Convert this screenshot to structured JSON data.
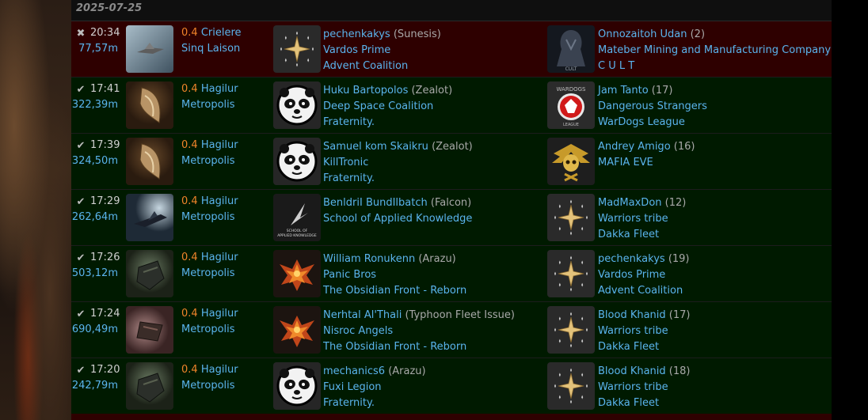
{
  "date": "2025-07-25",
  "kills": [
    {
      "type": "loss",
      "status_icon": "close-icon",
      "status_glyph": "✖",
      "time": "20:34",
      "isk": "77,57m",
      "ship_icon": "frigate-ship-icon",
      "security": "0.4",
      "system": "Crielere",
      "region": "Sinq Laison",
      "victim": {
        "logo": "star-emblem-icon",
        "pilot": "pechenkakys",
        "ship": "(Sunesis)",
        "corp": "Vardos Prime",
        "alliance": "Advent Coalition"
      },
      "final_blow": {
        "logo": "cult-dark-icon",
        "pilot": "Onnozaitoh Udan",
        "count": "(2)",
        "corp": "Mateber Mining and Manufacturing Company",
        "alliance": "C U L T"
      }
    },
    {
      "type": "win",
      "status_icon": "check-icon",
      "status_glyph": "✔",
      "time": "17:41",
      "isk": "322,39m",
      "ship_icon": "zealot-ship-icon",
      "security": "0.4",
      "system": "Hagilur",
      "region": "Metropolis",
      "victim": {
        "logo": "panda-icon",
        "pilot": "Huku Bartopolos",
        "ship": "(Zealot)",
        "corp": "Deep Space Coalition",
        "alliance": "Fraternity."
      },
      "final_blow": {
        "logo": "wardogs-icon",
        "pilot": "Jam Tanto",
        "count": "(17)",
        "corp": "Dangerous Strangers",
        "alliance": "WarDogs League"
      }
    },
    {
      "type": "win",
      "status_icon": "check-icon",
      "status_glyph": "✔",
      "time": "17:39",
      "isk": "324,50m",
      "ship_icon": "zealot-ship-icon",
      "security": "0.4",
      "system": "Hagilur",
      "region": "Metropolis",
      "victim": {
        "logo": "panda-icon",
        "pilot": "Samuel kom Skaikru",
        "ship": "(Zealot)",
        "corp": "KillTronic",
        "alliance": "Fraternity."
      },
      "final_blow": {
        "logo": "skull-wings-icon",
        "pilot": "Andrey Amigo",
        "count": "(16)",
        "corp": "MAFIA EVE",
        "alliance": ""
      }
    },
    {
      "type": "win",
      "status_icon": "check-icon",
      "status_glyph": "✔",
      "time": "17:29",
      "isk": "262,64m",
      "ship_icon": "falcon-ship-icon",
      "security": "0.4",
      "system": "Hagilur",
      "region": "Metropolis",
      "victim": {
        "logo": "school-applied-knowledge-icon",
        "logo_text": "SCHOOL OF APPLIED KNOWLEDGE",
        "pilot": "BenldriI BundIlbatch",
        "ship": "(Falcon)",
        "corp": "School of Applied Knowledge",
        "alliance": ""
      },
      "final_blow": {
        "logo": "star-emblem-icon",
        "pilot": "MadMaxDon",
        "count": "(12)",
        "corp": "Warriors tribe",
        "alliance": "Dakka Fleet"
      }
    },
    {
      "type": "win",
      "status_icon": "check-icon",
      "status_glyph": "✔",
      "time": "17:26",
      "isk": "503,12m",
      "ship_icon": "arazu-ship-icon",
      "security": "0.4",
      "system": "Hagilur",
      "region": "Metropolis",
      "victim": {
        "logo": "phoenix-icon",
        "pilot": "William Ronukenn",
        "ship": "(Arazu)",
        "corp": "Panic Bros",
        "alliance": "The Obsidian Front - Reborn"
      },
      "final_blow": {
        "logo": "star-emblem-icon",
        "pilot": "pechenkakys",
        "count": "(19)",
        "corp": "Vardos Prime",
        "alliance": "Advent Coalition"
      }
    },
    {
      "type": "win",
      "status_icon": "check-icon",
      "status_glyph": "✔",
      "time": "17:24",
      "isk": "690,49m",
      "ship_icon": "typhoon-ship-icon",
      "security": "0.4",
      "system": "Hagilur",
      "region": "Metropolis",
      "victim": {
        "logo": "phoenix-icon",
        "pilot": "Nerhtal Al'Thali",
        "ship": "(Typhoon Fleet Issue)",
        "corp": "Nisroc Angels",
        "alliance": "The Obsidian Front - Reborn"
      },
      "final_blow": {
        "logo": "star-emblem-icon",
        "pilot": "Blood Khanid",
        "count": "(17)",
        "corp": "Warriors tribe",
        "alliance": "Dakka Fleet"
      }
    },
    {
      "type": "win",
      "status_icon": "check-icon",
      "status_glyph": "✔",
      "time": "17:20",
      "isk": "242,79m",
      "ship_icon": "arazu-ship-icon",
      "security": "0.4",
      "system": "Hagilur",
      "region": "Metropolis",
      "victim": {
        "logo": "panda-icon",
        "pilot": "mechanics6",
        "ship": "(Arazu)",
        "corp": "Fuxi Legion",
        "alliance": "Fraternity."
      },
      "final_blow": {
        "logo": "star-emblem-icon",
        "pilot": "Blood Khanid",
        "count": "(18)",
        "corp": "Warriors tribe",
        "alliance": "Dakka Fleet"
      }
    }
  ],
  "colors": {
    "link": "#5ab4ee",
    "security_04": "#f0842a",
    "loss_row": "#2e0000",
    "win_row": "#001a00"
  }
}
